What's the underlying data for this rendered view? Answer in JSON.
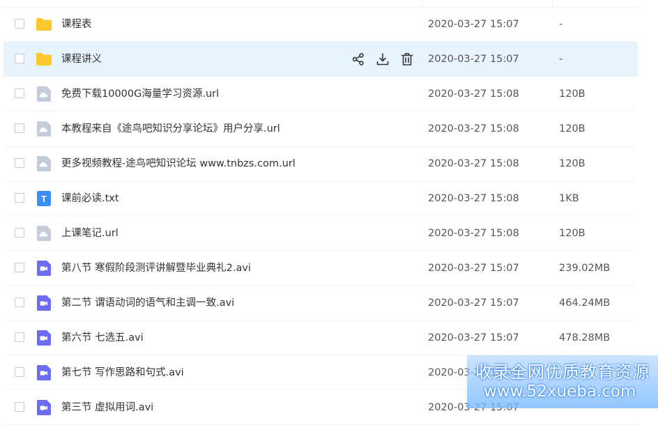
{
  "files": [
    {
      "name": "课程表",
      "date": "2020-03-27 15:07",
      "size": "-",
      "type": "folder"
    },
    {
      "name": "课程讲义",
      "date": "2020-03-27 15:07",
      "size": "-",
      "type": "folder",
      "selected": true
    },
    {
      "name": "免费下载10000G海量学习资源.url",
      "date": "2020-03-27 15:08",
      "size": "120B",
      "type": "url"
    },
    {
      "name": "本教程来自《途鸟吧知识分享论坛》用户分享.url",
      "date": "2020-03-27 15:08",
      "size": "120B",
      "type": "url"
    },
    {
      "name": "更多视频教程-途鸟吧知识论坛 www.tnbzs.com.url",
      "date": "2020-03-27 15:08",
      "size": "120B",
      "type": "url"
    },
    {
      "name": "课前必读.txt",
      "date": "2020-03-27 15:08",
      "size": "1KB",
      "type": "txt"
    },
    {
      "name": "上课笔记.url",
      "date": "2020-03-27 15:08",
      "size": "120B",
      "type": "url"
    },
    {
      "name": "第八节 寒假阶段测评讲解暨毕业典礼2.avi",
      "date": "2020-03-27 15:07",
      "size": "239.02MB",
      "type": "video"
    },
    {
      "name": "第二节 谓语动词的语气和主调一致.avi",
      "date": "2020-03-27 15:07",
      "size": "464.24MB",
      "type": "video"
    },
    {
      "name": "第六节 七选五.avi",
      "date": "2020-03-27 15:07",
      "size": "478.28MB",
      "type": "video"
    },
    {
      "name": "第七节 写作思路和句式.avi",
      "date": "2020-03-27 15:07",
      "size": "",
      "type": "video"
    },
    {
      "name": "第三节 虚拟用词.avi",
      "date": "2020-03-27 15:07",
      "size": "",
      "type": "video"
    }
  ],
  "row_actions": [
    "share-icon",
    "download-icon",
    "delete-icon"
  ],
  "icon_glyphs": {
    "txt": "T"
  },
  "watermark": {
    "line1": "收录全网优质教育资源",
    "line2": "www.52xueba.com"
  },
  "colors": {
    "folder": "#fcc82e",
    "url": "#c3ccd8",
    "txt": "#3b8ef6",
    "video": "#6b6cf0",
    "selected_row": "#e7f3fd"
  }
}
